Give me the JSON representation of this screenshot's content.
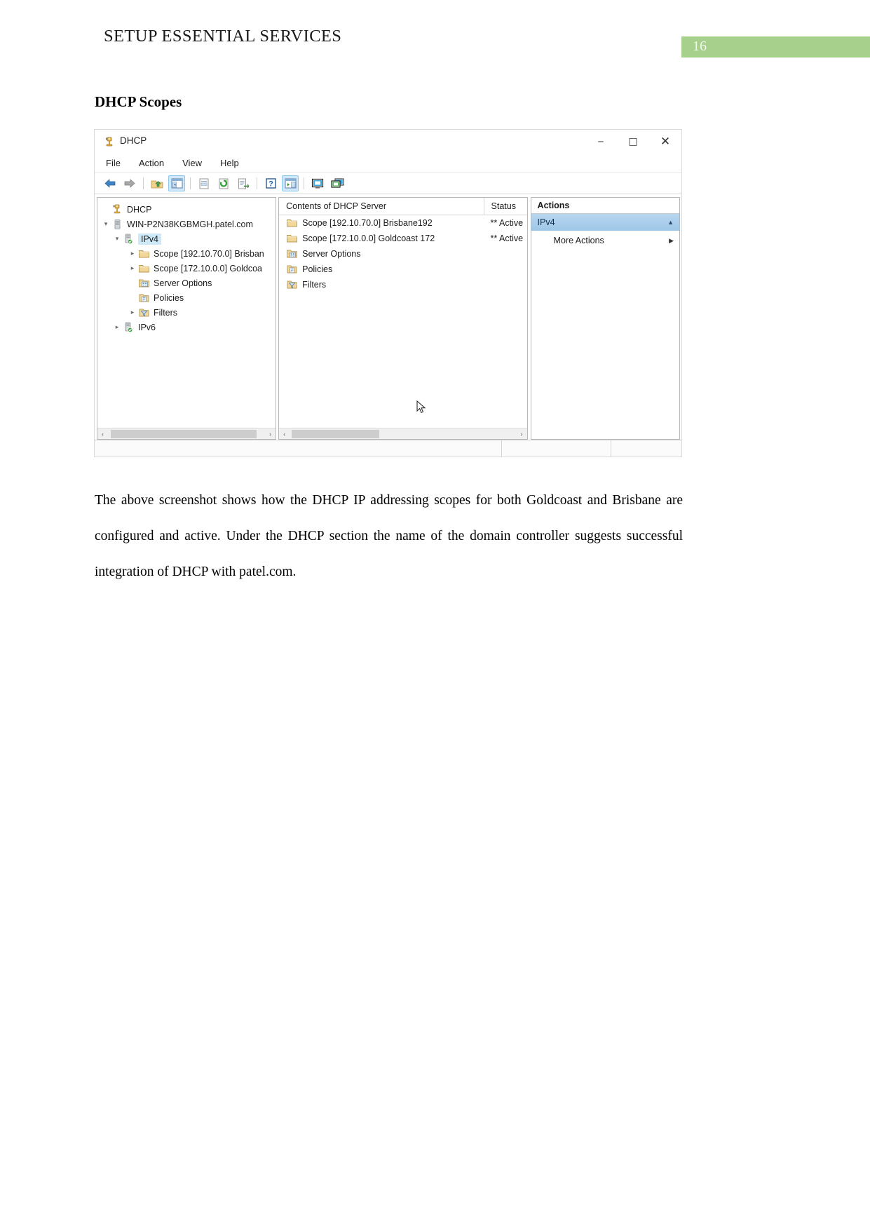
{
  "document": {
    "header_title": "SETUP ESSENTIAL SERVICES",
    "page_number": "16",
    "page_badge_color": "#a8d08d",
    "section_heading": "DHCP Scopes",
    "paragraph": "The above screenshot shows how the DHCP IP addressing scopes for both Goldcoast and Brisbane are configured and active. Under the DHCP section the name of the domain controller suggests successful integration of DHCP with patel.com."
  },
  "window": {
    "title": "DHCP",
    "icon": "dhcp-server-icon",
    "controls": {
      "minimize": "‒",
      "maximize": "□",
      "close": "✕"
    },
    "menu": [
      {
        "label": "File"
      },
      {
        "label": "Action"
      },
      {
        "label": "View"
      },
      {
        "label": "Help"
      }
    ],
    "toolbar": [
      {
        "name": "back-arrow-icon",
        "selected": false
      },
      {
        "name": "forward-arrow-icon",
        "selected": false
      },
      {
        "name": "separator",
        "selected": false
      },
      {
        "name": "up-one-level-icon",
        "selected": false
      },
      {
        "name": "show-hide-console-tree-icon",
        "selected": true
      },
      {
        "name": "separator",
        "selected": false
      },
      {
        "name": "properties-icon",
        "selected": false
      },
      {
        "name": "refresh-icon",
        "selected": false
      },
      {
        "name": "export-list-icon",
        "selected": false
      },
      {
        "name": "separator",
        "selected": false
      },
      {
        "name": "help-icon",
        "selected": false
      },
      {
        "name": "show-hide-action-pane-icon",
        "selected": true
      },
      {
        "name": "separator",
        "selected": false
      },
      {
        "name": "new-window-icon",
        "selected": false
      },
      {
        "name": "new-window-from-here-icon",
        "selected": false
      }
    ]
  },
  "tree": {
    "nodes": [
      {
        "label": "DHCP",
        "depth": 0,
        "twist": "",
        "icon": "dhcp-root-icon",
        "selected": false
      },
      {
        "label": "WIN-P2N38KGBMGH.patel.com",
        "depth": 1,
        "twist": "expanded",
        "icon": "server-icon",
        "selected": false
      },
      {
        "label": "IPv4",
        "depth": 2,
        "twist": "expanded",
        "icon": "ipv4-ok-icon",
        "selected": true
      },
      {
        "label": "Scope [192.10.70.0] Brisban",
        "depth": 3,
        "twist": "collapsed",
        "icon": "scope-folder-icon",
        "selected": false
      },
      {
        "label": "Scope [172.10.0.0] Goldcoa",
        "depth": 3,
        "twist": "collapsed",
        "icon": "scope-folder-icon",
        "selected": false
      },
      {
        "label": "Server Options",
        "depth": 3,
        "twist": "",
        "icon": "server-options-icon",
        "selected": false
      },
      {
        "label": "Policies",
        "depth": 3,
        "twist": "",
        "icon": "policies-icon",
        "selected": false
      },
      {
        "label": "Filters",
        "depth": 3,
        "twist": "collapsed",
        "icon": "filters-icon",
        "selected": false
      },
      {
        "label": "IPv6",
        "depth": 2,
        "twist": "collapsed",
        "icon": "ipv6-ok-icon",
        "selected": false
      }
    ]
  },
  "list": {
    "columns": {
      "name": "Contents of DHCP Server",
      "status": "Status"
    },
    "rows": [
      {
        "name": "Scope [192.10.70.0] Brisbane192",
        "status": "** Active",
        "icon": "scope-folder-icon"
      },
      {
        "name": "Scope [172.10.0.0] Goldcoast 172",
        "status": "** Active",
        "icon": "scope-folder-icon"
      },
      {
        "name": "Server Options",
        "status": "",
        "icon": "server-options-icon"
      },
      {
        "name": "Policies",
        "status": "",
        "icon": "policies-icon"
      },
      {
        "name": "Filters",
        "status": "",
        "icon": "filters-icon"
      }
    ]
  },
  "actions": {
    "header": "Actions",
    "selected_item": "IPv4",
    "selected_chevron": "▲",
    "more_actions": "More Actions",
    "more_actions_chevron": "▶"
  },
  "scroll": {
    "left_arrow": "‹",
    "right_arrow": "›"
  }
}
